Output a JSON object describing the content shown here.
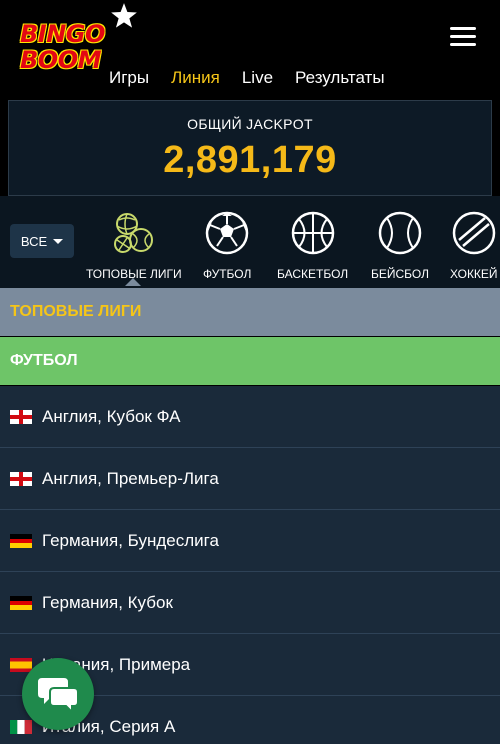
{
  "header": {
    "logo_line1": "BINGO",
    "logo_line2": "BOOM",
    "nav": [
      {
        "label": "Игры",
        "active": false
      },
      {
        "label": "Линия",
        "active": true
      },
      {
        "label": "Live",
        "active": false
      },
      {
        "label": "Результаты",
        "active": false
      }
    ]
  },
  "jackpot": {
    "label": "ОБЩИЙ JACKPOT",
    "value": "2,891,179"
  },
  "sports": {
    "all_label": "ВСЕ",
    "items": [
      {
        "label": "ТОПОВЫЕ ЛИГИ",
        "icon": "top-leagues-icon"
      },
      {
        "label": "ФУТБОЛ",
        "icon": "football-icon"
      },
      {
        "label": "БАСКЕТБОЛ",
        "icon": "basketball-icon"
      },
      {
        "label": "БЕЙСБОЛ",
        "icon": "baseball-icon"
      },
      {
        "label": "ХОККЕЙ",
        "icon": "hockey-icon"
      }
    ]
  },
  "sections": {
    "top_leagues": "ТОПОВЫЕ ЛИГИ",
    "football": "ФУТБОЛ"
  },
  "leagues": [
    {
      "label": "Англия, Кубок ФА",
      "flag": "england-flag-icon"
    },
    {
      "label": "Англия, Премьер-Лига",
      "flag": "england-flag-icon"
    },
    {
      "label": "Германия, Бундеслига",
      "flag": "germany-flag-icon"
    },
    {
      "label": "Германия, Кубок",
      "flag": "germany-flag-icon"
    },
    {
      "label": "Испания, Примера",
      "flag": "spain-flag-icon"
    },
    {
      "label": "Италия, Серия А",
      "flag": "italy-flag-icon"
    }
  ],
  "colors": {
    "accent": "#f5c518",
    "section_top": "#7b8b9d",
    "section_football": "#6ec568",
    "list_bg": "#1a2a3a",
    "chat": "#1f8a4c"
  }
}
